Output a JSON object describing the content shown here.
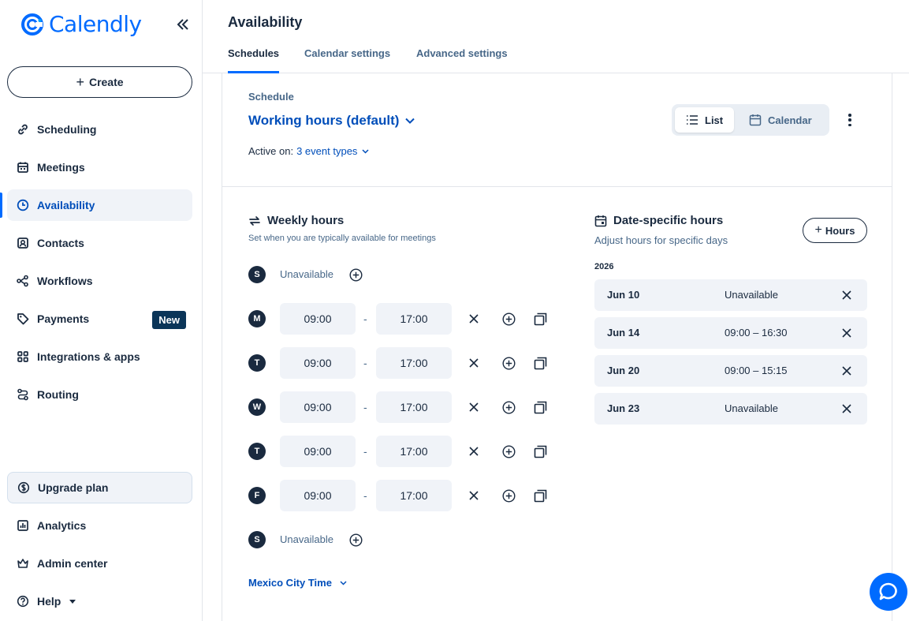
{
  "brand": {
    "name": "Calendly",
    "color": "#006bff"
  },
  "sidebar": {
    "create_label": "Create",
    "items": [
      {
        "label": "Scheduling",
        "icon": "link-icon"
      },
      {
        "label": "Meetings",
        "icon": "calendar-icon"
      },
      {
        "label": "Availability",
        "icon": "clock-icon",
        "active": true
      },
      {
        "label": "Contacts",
        "icon": "contacts-icon"
      },
      {
        "label": "Workflows",
        "icon": "workflow-icon"
      },
      {
        "label": "Payments",
        "icon": "tag-icon",
        "badge": "New"
      },
      {
        "label": "Integrations & apps",
        "icon": "apps-grid-icon"
      },
      {
        "label": "Routing",
        "icon": "routing-icon"
      }
    ],
    "bottom_items": [
      {
        "label": "Upgrade plan",
        "icon": "dollar-icon"
      },
      {
        "label": "Analytics",
        "icon": "analytics-icon"
      },
      {
        "label": "Admin center",
        "icon": "crown-icon"
      },
      {
        "label": "Help",
        "icon": "help-icon"
      }
    ]
  },
  "header": {
    "title": "Availability",
    "tabs": [
      "Schedules",
      "Calendar settings",
      "Advanced settings"
    ]
  },
  "schedule": {
    "label": "Schedule",
    "name": "Working hours (default)",
    "active_on_label": "Active on:",
    "active_on_value": "3 event types",
    "view_list": "List",
    "view_calendar": "Calendar"
  },
  "weekly": {
    "title": "Weekly hours",
    "subtitle": "Set when you are typically available for meetings",
    "dash": "-",
    "days": [
      {
        "letter": "S",
        "unavailable": "Unavailable"
      },
      {
        "letter": "M",
        "start": "09:00",
        "end": "17:00"
      },
      {
        "letter": "T",
        "start": "09:00",
        "end": "17:00"
      },
      {
        "letter": "W",
        "start": "09:00",
        "end": "17:00"
      },
      {
        "letter": "T",
        "start": "09:00",
        "end": "17:00"
      },
      {
        "letter": "F",
        "start": "09:00",
        "end": "17:00"
      },
      {
        "letter": "S",
        "unavailable": "Unavailable"
      }
    ],
    "timezone": "Mexico City Time"
  },
  "date_specific": {
    "title": "Date-specific hours",
    "subtitle": "Adjust hours for specific days",
    "add_label": "Hours",
    "year": "2026",
    "entries": [
      {
        "date": "Jun 10",
        "hours": "Unavailable"
      },
      {
        "date": "Jun 14",
        "hours": "09:00 – 16:30"
      },
      {
        "date": "Jun 20",
        "hours": "09:00 – 15:15"
      },
      {
        "date": "Jun 23",
        "hours": "Unavailable"
      }
    ]
  }
}
